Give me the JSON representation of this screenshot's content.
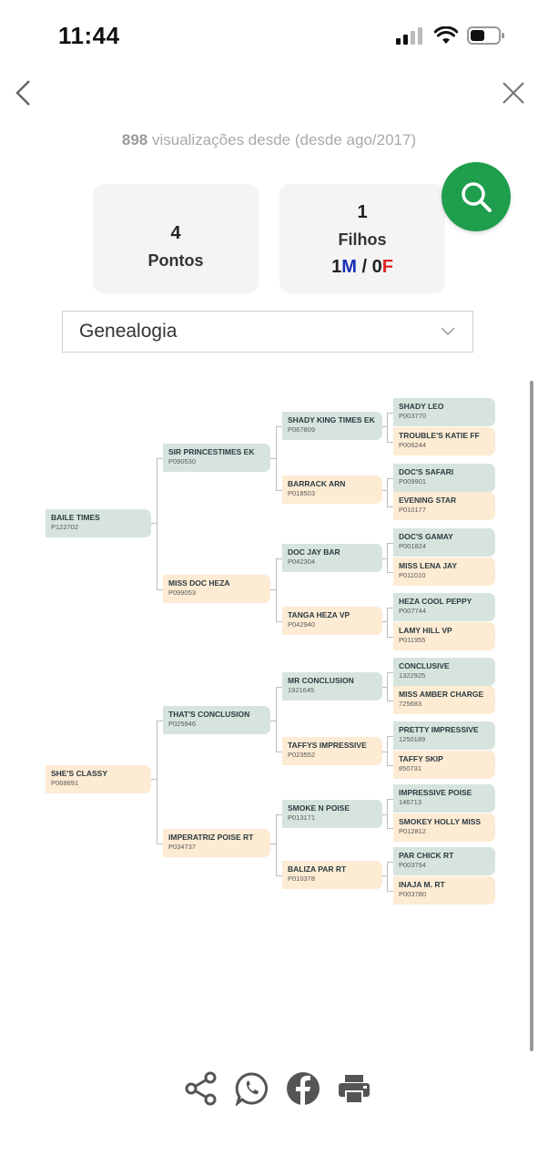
{
  "status": {
    "time": "11:44"
  },
  "nav": {
    "back_icon": "chevron-left-icon",
    "close_icon": "close-icon"
  },
  "views": {
    "count": "898",
    "text": "visualizações desde",
    "since": "(desde ago/2017)"
  },
  "stats": {
    "pontos_value": "4",
    "pontos_label": "Pontos",
    "filhos_value": "1",
    "filhos_label": "Filhos",
    "m_count": "1",
    "m_letter": "M",
    "sep": " / ",
    "f_count": "0",
    "f_letter": "F"
  },
  "colors": {
    "search": "#1f9e4d",
    "male": "#1a2fb5",
    "female": "#e02323",
    "green_box": "#d7e4de",
    "orange_box": "#fdebd3"
  },
  "select": {
    "value": "Genealogia"
  },
  "pedigree": {
    "sire": {
      "name": "BAILE TIMES",
      "code": "P122702"
    },
    "dam": {
      "name": "SHE'S CLASSY",
      "code": "P068691"
    },
    "gen2": [
      {
        "name": "SIR PRINCESTIMES EK",
        "code": "P090530"
      },
      {
        "name": "MISS DOC HEZA",
        "code": "P099053"
      },
      {
        "name": "THAT'S CONCLUSION",
        "code": "P025946"
      },
      {
        "name": "IMPERATRIZ POISE RT",
        "code": "P034737"
      }
    ],
    "gen3": [
      {
        "name": "SHADY KING TIMES EK",
        "code": "P067809"
      },
      {
        "name": "BARRACK ARN",
        "code": "P018503"
      },
      {
        "name": "DOC JAY BAR",
        "code": "P042304"
      },
      {
        "name": "TANGA HEZA VP",
        "code": "P042940"
      },
      {
        "name": "MR CONCLUSION",
        "code": "1921645"
      },
      {
        "name": "TAFFYS IMPRESSIVE",
        "code": "P023552"
      },
      {
        "name": "SMOKE N POISE",
        "code": "P013171"
      },
      {
        "name": "BALIZA PAR RT",
        "code": "P010378"
      }
    ],
    "gen4": [
      {
        "name": "SHADY LEO",
        "code": "P003770"
      },
      {
        "name": "TROUBLE'S KATIE FF",
        "code": "P006244"
      },
      {
        "name": "DOC'S SAFARI",
        "code": "P009901"
      },
      {
        "name": "EVENING STAR",
        "code": "P010177"
      },
      {
        "name": "DOC'S GAMAY",
        "code": "P001824"
      },
      {
        "name": "MISS LENA JAY",
        "code": "P011010"
      },
      {
        "name": "HEZA COOL PEPPY",
        "code": "P007744"
      },
      {
        "name": "LAMY HILL VP",
        "code": "P011955"
      },
      {
        "name": "CONCLUSIVE",
        "code": "1322925"
      },
      {
        "name": "MISS AMBER CHARGE",
        "code": "725683"
      },
      {
        "name": "PRETTY IMPRESSIVE",
        "code": "1250189"
      },
      {
        "name": "TAFFY SKIP",
        "code": "850731"
      },
      {
        "name": "IMPRESSIVE POISE",
        "code": "146713"
      },
      {
        "name": "SMOKEY HOLLY MISS",
        "code": "P012812"
      },
      {
        "name": "PAR CHICK RT",
        "code": "P003794"
      },
      {
        "name": "INAJA M. RT",
        "code": "P003780"
      }
    ]
  },
  "share": {
    "icons": [
      "share-icon",
      "whatsapp-icon",
      "facebook-icon",
      "print-icon"
    ]
  }
}
